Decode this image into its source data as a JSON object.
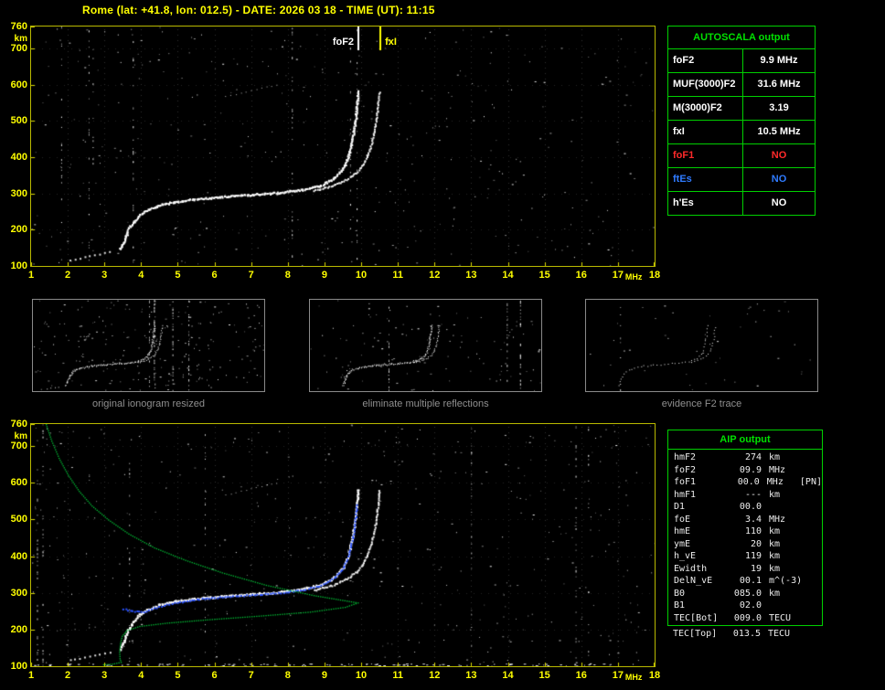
{
  "title": "Rome (lat: +41.8, lon: 012.5) - DATE: 2026 03 18 - TIME (UT): 11:15",
  "colors": {
    "axis_yellow": "#ffff00",
    "border_yellow": "#b9b900",
    "table_green": "#00d000",
    "trace_white": "#ffffff",
    "profile_green": "#00c838",
    "fit_blue": "#2850ff",
    "no_red": "#ff2a2a",
    "no_blue": "#2f7bff",
    "caption_gray": "#8f8f8f"
  },
  "axes": {
    "x_ticks": [
      1,
      2,
      3,
      4,
      5,
      6,
      7,
      8,
      9,
      10,
      11,
      12,
      13,
      14,
      15,
      16,
      17,
      18
    ],
    "x_unit": "MHz",
    "y_ticks": [
      760,
      700,
      600,
      500,
      400,
      300,
      200,
      100
    ],
    "y_unit": "km",
    "x_range": [
      1,
      18
    ],
    "y_range": [
      100,
      760
    ]
  },
  "autoscala_table": {
    "header": "AUTOSCALA output",
    "rows": [
      {
        "label": "foF2",
        "value": "9.9 MHz",
        "color": "#ffffff"
      },
      {
        "label": "MUF(3000)F2",
        "value": "31.6 MHz",
        "color": "#ffffff"
      },
      {
        "label": "M(3000)F2",
        "value": "3.19",
        "color": "#ffffff"
      },
      {
        "label": "fxI",
        "value": "10.5 MHz",
        "color": "#ffffff"
      },
      {
        "label": "foF1",
        "value": "NO",
        "color": "#ff2a2a"
      },
      {
        "label": "ftEs",
        "value": "NO",
        "color": "#2f7bff"
      },
      {
        "label": "h'Es",
        "value": "NO",
        "color": "#ffffff"
      }
    ]
  },
  "aip_panel": {
    "header": "AIP output",
    "rows": [
      {
        "label": "hmF2",
        "value": "274",
        "unit": "km"
      },
      {
        "label": "foF2",
        "value": "09.9",
        "unit": "MHz"
      },
      {
        "label": "foF1",
        "value": "00.0",
        "unit": "MHz   [PN]"
      },
      {
        "label": "hmF1",
        "value": "---",
        "unit": "km"
      },
      {
        "label": "D1",
        "value": "00.0",
        "unit": ""
      },
      {
        "label": "foE",
        "value": "3.4",
        "unit": "MHz"
      },
      {
        "label": "hmE",
        "value": "110",
        "unit": "km"
      },
      {
        "label": "ymE",
        "value": "20",
        "unit": "km"
      },
      {
        "label": "h_vE",
        "value": "119",
        "unit": "km"
      },
      {
        "label": "Ewidth",
        "value": "19",
        "unit": "km"
      },
      {
        "label": "DelN_vE",
        "value": "00.1",
        "unit": "m^(-3)"
      },
      {
        "label": "B0",
        "value": "085.0",
        "unit": "km"
      },
      {
        "label": "B1",
        "value": "02.0",
        "unit": ""
      },
      {
        "label": "TEC[Bot]",
        "value": "009.0",
        "unit": "TECU"
      }
    ],
    "footer_row": {
      "label": "TEC[Top]",
      "value": "013.5",
      "unit": "TECU"
    }
  },
  "thumbnails": {
    "captions": [
      "original ionogram resized",
      "eliminate multiple reflections",
      "evidence F2 trace"
    ]
  },
  "plots": {
    "x_range": [
      1,
      18
    ],
    "y_range": [
      100,
      760
    ],
    "markers": [
      {
        "f": 9.9,
        "label": "foF2",
        "color": "#ffffff",
        "side": "left"
      },
      {
        "f": 10.5,
        "label": "fxI",
        "color": "#ffff00",
        "side": "right"
      }
    ],
    "o_trace": [
      [
        3.42,
        148
      ],
      [
        3.55,
        178
      ],
      [
        3.65,
        205
      ],
      [
        3.8,
        225
      ],
      [
        3.95,
        242
      ],
      [
        4.15,
        255
      ],
      [
        4.45,
        268
      ],
      [
        4.9,
        278
      ],
      [
        5.5,
        286
      ],
      [
        6.2,
        292
      ],
      [
        7.0,
        298
      ],
      [
        7.8,
        304
      ],
      [
        8.4,
        312
      ],
      [
        8.9,
        324
      ],
      [
        9.25,
        344
      ],
      [
        9.5,
        372
      ],
      [
        9.65,
        408
      ],
      [
        9.75,
        452
      ],
      [
        9.83,
        505
      ],
      [
        9.88,
        552
      ],
      [
        9.9,
        588
      ]
    ],
    "x_trace": [
      [
        8.7,
        310
      ],
      [
        9.2,
        322
      ],
      [
        9.6,
        340
      ],
      [
        9.9,
        362
      ],
      [
        10.1,
        392
      ],
      [
        10.25,
        432
      ],
      [
        10.37,
        485
      ],
      [
        10.44,
        540
      ],
      [
        10.48,
        585
      ]
    ],
    "second_hop": [
      [
        6.3,
        568
      ],
      [
        7.0,
        584
      ],
      [
        7.75,
        602
      ]
    ],
    "es_bits": [
      [
        2.05,
        118
      ],
      [
        2.45,
        126
      ],
      [
        2.85,
        134
      ],
      [
        3.2,
        142
      ]
    ],
    "blue_trace": [
      [
        3.5,
        258
      ],
      [
        3.75,
        252
      ],
      [
        4.05,
        250
      ],
      [
        4.4,
        262
      ],
      [
        4.9,
        274
      ],
      [
        5.5,
        284
      ],
      [
        6.2,
        290
      ],
      [
        7.0,
        296
      ],
      [
        7.8,
        302
      ],
      [
        8.4,
        310
      ],
      [
        8.9,
        322
      ],
      [
        9.25,
        342
      ],
      [
        9.5,
        370
      ],
      [
        9.65,
        406
      ],
      [
        9.75,
        450
      ],
      [
        9.83,
        503
      ],
      [
        9.87,
        548
      ]
    ],
    "profile": [
      [
        1.4,
        760
      ],
      [
        1.55,
        715
      ],
      [
        1.75,
        668
      ],
      [
        2.0,
        622
      ],
      [
        2.3,
        578
      ],
      [
        2.65,
        538
      ],
      [
        3.1,
        500
      ],
      [
        3.65,
        462
      ],
      [
        4.35,
        424
      ],
      [
        5.2,
        390
      ],
      [
        6.2,
        356
      ],
      [
        7.4,
        322
      ],
      [
        8.7,
        294
      ],
      [
        9.6,
        279
      ],
      [
        9.9,
        274
      ],
      [
        9.55,
        262
      ],
      [
        8.6,
        249
      ],
      [
        7.2,
        238
      ],
      [
        5.8,
        228
      ],
      [
        4.7,
        219
      ],
      [
        3.95,
        210
      ],
      [
        3.6,
        199
      ],
      [
        3.47,
        183
      ],
      [
        3.42,
        162
      ],
      [
        3.4,
        140
      ],
      [
        3.41,
        122
      ],
      [
        3.44,
        112
      ],
      [
        3.2,
        107
      ],
      [
        2.9,
        105
      ]
    ],
    "panels": {
      "top": {
        "seed": 11,
        "noise": 380,
        "columns": 7,
        "grid": true,
        "markers": true,
        "ticks": true,
        "traces": [
          "o",
          "x",
          "hop",
          "es"
        ]
      },
      "bottom": {
        "seed": 23,
        "noise": 430,
        "columns": 8,
        "grid": true,
        "markers": false,
        "ticks": true,
        "band": true,
        "traces": [
          "o",
          "x",
          "hop",
          "es",
          "blue",
          "profile"
        ]
      },
      "thumb1": {
        "seed": 31,
        "noise": 230,
        "columns": 5,
        "grid": false,
        "w": 1,
        "traces": [
          "o",
          "x",
          "es"
        ]
      },
      "thumb2": {
        "seed": 41,
        "noise": 120,
        "columns": 3,
        "grid": false,
        "w": 1,
        "traces": [
          "o",
          "x"
        ]
      },
      "thumb3": {
        "seed": 51,
        "noise": 45,
        "columns": 1,
        "grid": false,
        "w": 1,
        "sparse": true,
        "traces": [
          "o",
          "x"
        ]
      }
    }
  }
}
